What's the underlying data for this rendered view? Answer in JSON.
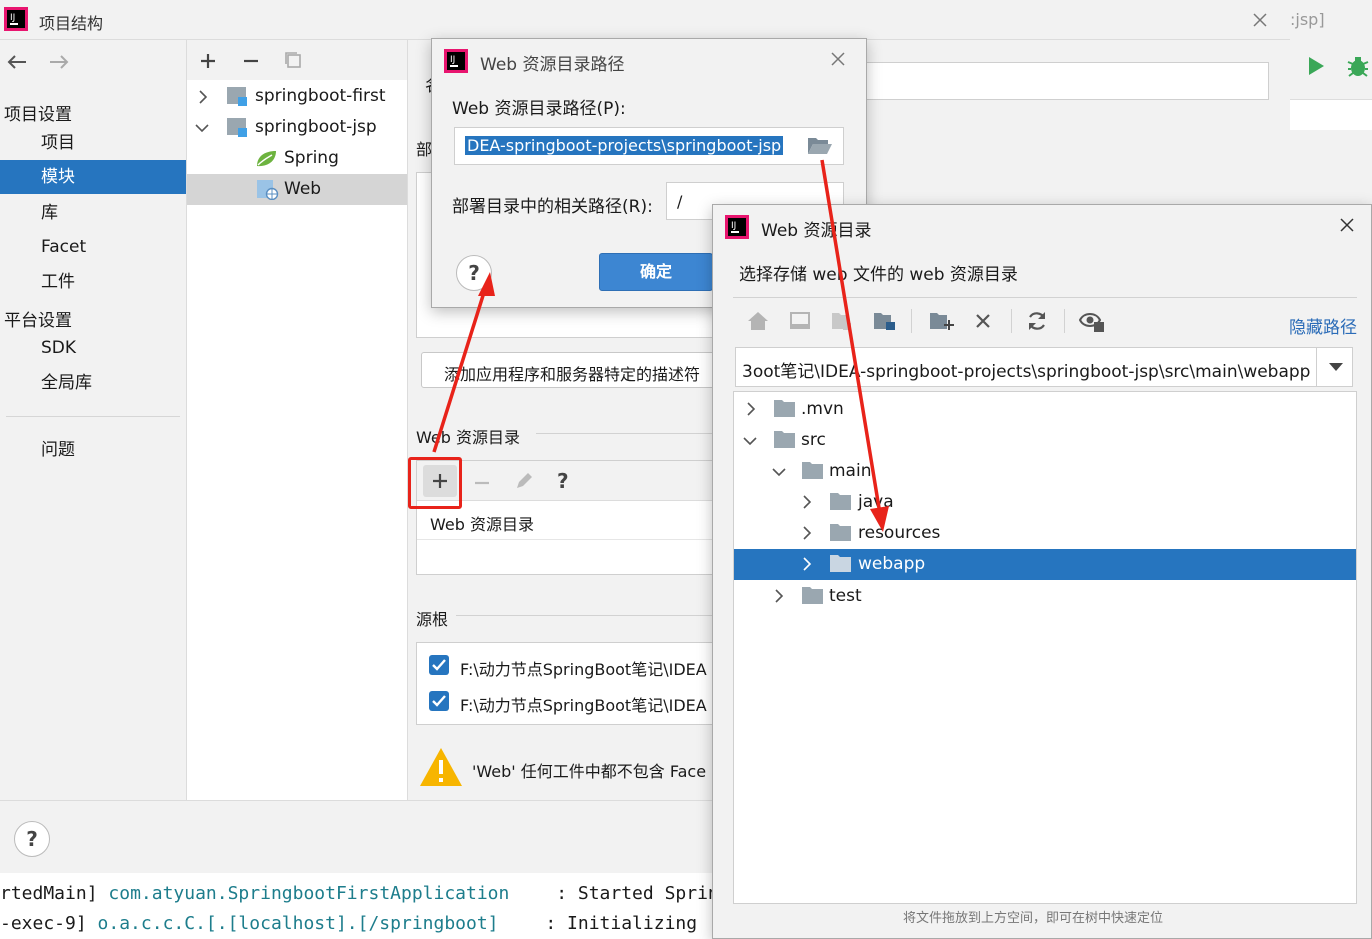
{
  "main_window": {
    "title": "项目结构",
    "title_bg_fragment": ":jsp]",
    "nav": {
      "project_settings_header": "项目设置",
      "items_project": [
        "项目",
        "模块",
        "库",
        "Facet",
        "工件"
      ],
      "platform_settings_header": "平台设置",
      "items_platform": [
        "SDK",
        "全局库"
      ],
      "problems": "问题"
    },
    "module_tree": {
      "items": [
        "springboot-first",
        "springboot-jsp",
        "Spring",
        "Web"
      ]
    },
    "content": {
      "name_label_fragment": "名",
      "deploy_label_fragment": "部",
      "add_descriptor_button": "添加应用程序和服务器特定的描述符",
      "web_resource_section": "Web 资源目录",
      "web_resource_column": "Web 资源目录",
      "source_roots_section": "源根",
      "source_roots": [
        {
          "path": "F:\\动力节点SpringBoot笔记\\IDEA",
          "checked": true
        },
        {
          "path": "F:\\动力节点SpringBoot笔记\\IDEA",
          "checked": true
        }
      ],
      "warning_text": "'Web' 任何工件中都不包含 Face"
    }
  },
  "dialog_path": {
    "title": "Web 资源目录路径",
    "path_label": "Web 资源目录路径(P):",
    "path_value": "DEA-springboot-projects\\springboot-jsp",
    "relative_label": "部署目录中的相关路径(R):",
    "relative_value": "/",
    "ok_button": "确定"
  },
  "dialog_chooser": {
    "title": "Web 资源目录",
    "description": "选择存储 web 文件的 web 资源目录",
    "hide_path_link": "隐藏路径",
    "path_value": "3oot笔记\\IDEA-springboot-projects\\springboot-jsp\\src\\main\\webapp",
    "tree": [
      ".mvn",
      "src",
      "main",
      "java",
      "resources",
      "webapp",
      "test"
    ],
    "footer_hint": "将文件拖放到上方空间，即可在树中快速定位"
  },
  "console": {
    "lines": [
      {
        "thread": "rtedMain]",
        "logger": "com.atyuan.SpringbootFirstApplication",
        "message": ": Started Sprin"
      },
      {
        "thread": "-exec-9]",
        "logger": "o.a.c.c.C.[.[localhost].[/springboot]",
        "message": ": Initializing"
      }
    ]
  },
  "colors": {
    "selection_blue": "#2675bf",
    "annotation_red": "#e8231a",
    "accent_green": "#3aa757"
  }
}
